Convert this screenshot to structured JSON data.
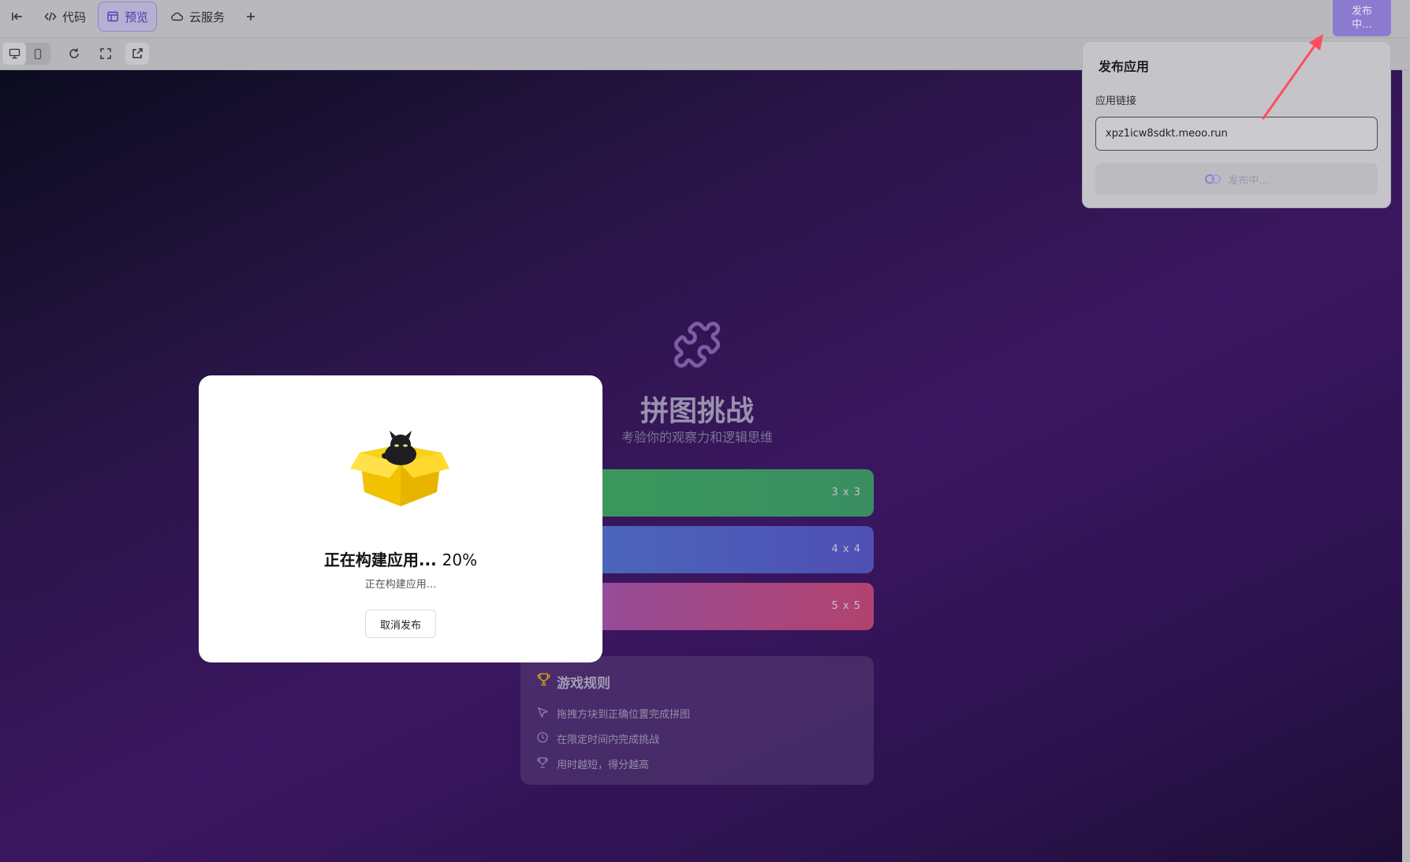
{
  "topbar": {
    "tabs": [
      {
        "label": "代码",
        "icon": "code-icon"
      },
      {
        "label": "预览",
        "icon": "layout-icon"
      },
      {
        "label": "云服务",
        "icon": "cloud-icon"
      }
    ],
    "add_icon": "plus-icon",
    "collapse_icon": "collapse-left-icon",
    "publish_label": "发布中..."
  },
  "toolbar": {
    "icons": [
      "desktop-icon",
      "mobile-icon",
      "refresh-icon",
      "fullscreen-icon",
      "external-link-icon"
    ]
  },
  "app": {
    "title": "拼图挑战",
    "subtitle": "考验你的观察力和逻辑思维",
    "levels": [
      {
        "label": "3 x 3",
        "color": "#3b9a63"
      },
      {
        "label": "4 x 4",
        "color": "#4a5fbd"
      },
      {
        "label": "5 x 5",
        "color": "#b44c8a"
      }
    ],
    "rules": {
      "title": "游戏规则",
      "items": [
        {
          "text": "拖拽方块到正确位置完成拼图",
          "icon": "pointer-icon"
        },
        {
          "text": "在限定时间内完成挑战",
          "icon": "clock-icon"
        },
        {
          "text": "用时越短，得分越高",
          "icon": "trophy-icon"
        }
      ]
    }
  },
  "build_dialog": {
    "title": "正在构建应用...",
    "percent": "20%",
    "progress": 0.2,
    "status": "正在构建应用...",
    "cancel_label": "取消发布"
  },
  "publish_popover": {
    "title": "发布应用",
    "link_label": "应用链接",
    "link_value": "xpz1icw8sdkt.meoo.run",
    "button_label": "发布中..."
  },
  "colors": {
    "accent": "#8b7bd0",
    "annotation_arrow": "#ff4d5e"
  }
}
